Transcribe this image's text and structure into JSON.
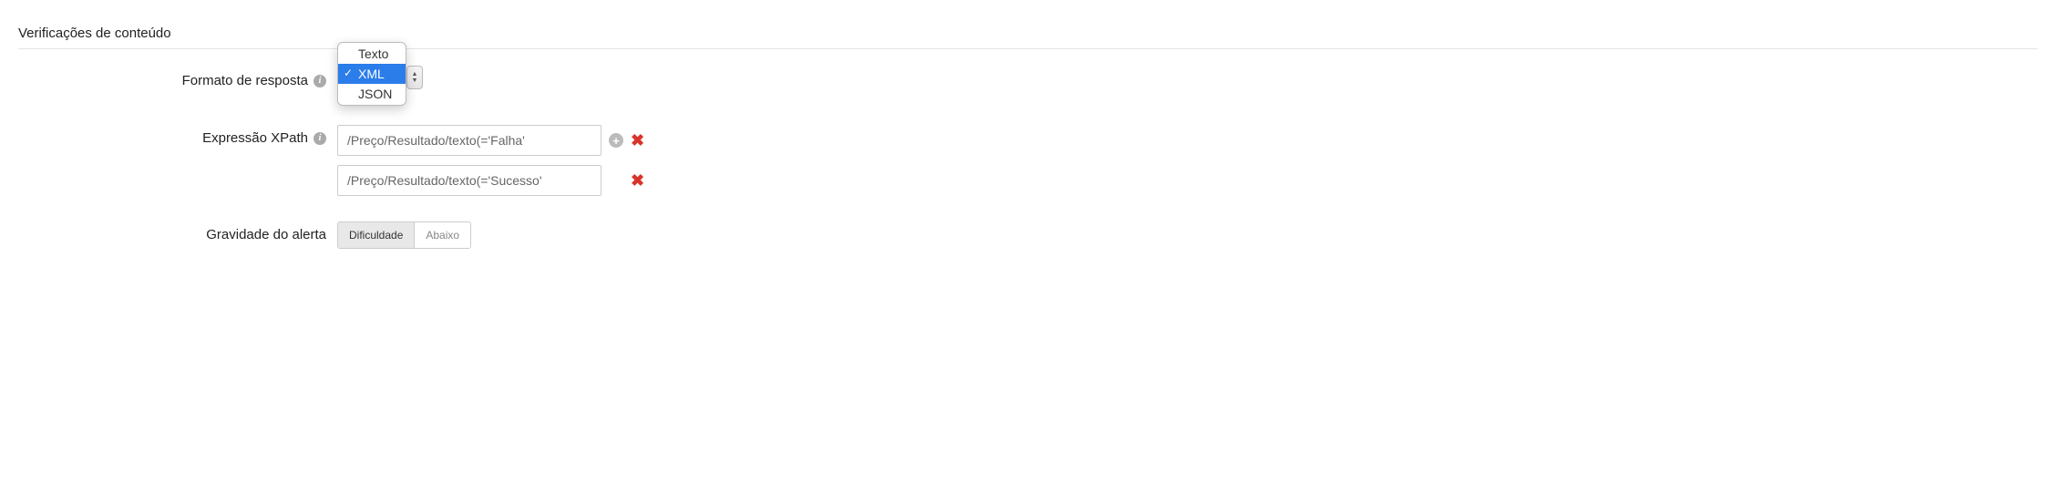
{
  "section": {
    "title": "Verificações de conteúdo"
  },
  "response_format": {
    "label": "Formato de resposta",
    "options": [
      "Texto",
      "XML",
      "JSON"
    ],
    "selected": "XML"
  },
  "xpath": {
    "label": "Expressão XPath",
    "expressions": [
      {
        "value": "/Preço/Resultado/texto(='Falha'",
        "can_add": true
      },
      {
        "value": "/Preço/Resultado/texto(='Sucesso'",
        "can_add": false
      }
    ]
  },
  "severity": {
    "label": "Gravidade do alerta",
    "options": [
      {
        "label": "Dificuldade",
        "active": true
      },
      {
        "label": "Abaixo",
        "active": false
      }
    ]
  }
}
